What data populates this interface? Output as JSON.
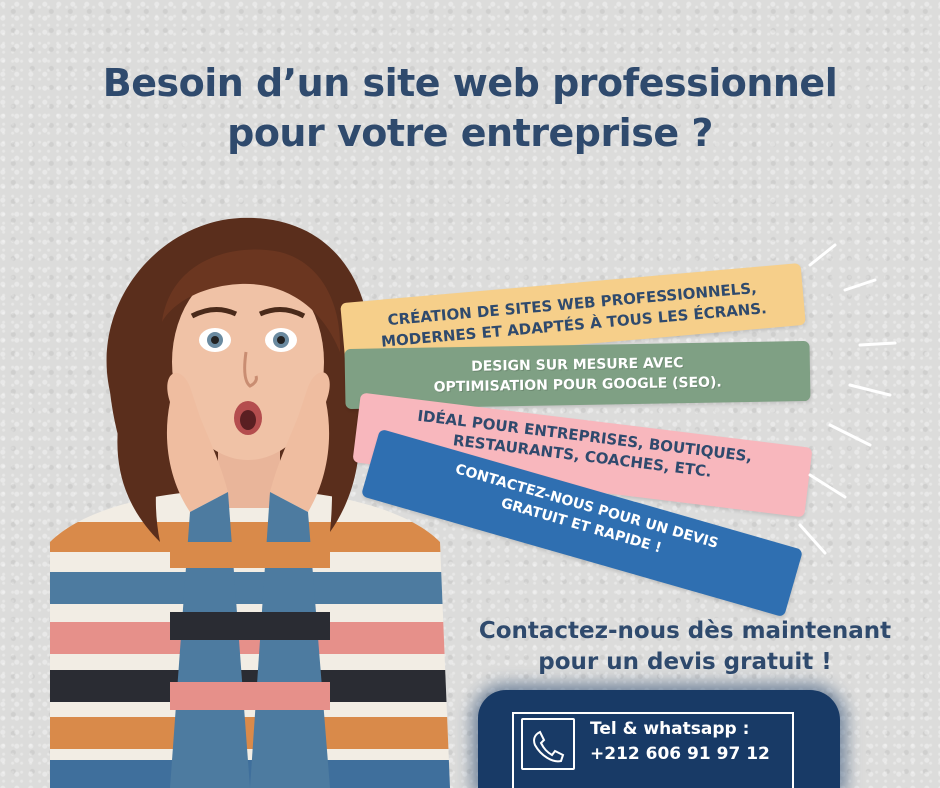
{
  "headline": {
    "line1": "Besoin d’un site web professionnel",
    "line2": "pour votre entreprise ?"
  },
  "banners": [
    {
      "lines": [
        "Création de sites web professionnels,",
        "modernes et adaptés à tous les écrans."
      ],
      "color": "#f6cf8a"
    },
    {
      "lines": [
        "Design sur mesure avec",
        "optimisation pour Google (SEO)."
      ],
      "color": "#7fa084"
    },
    {
      "lines": [
        "Idéal pour entreprises, boutiques,",
        "restaurants, coaches, etc."
      ],
      "color": "#f8b7bd"
    },
    {
      "lines": [
        "Contactez-nous pour un devis",
        "gratuit et rapide !"
      ],
      "color": "#2f6fb1"
    }
  ],
  "cta": {
    "line1": "Contactez-nous dès maintenant",
    "line2": "pour un devis gratuit !"
  },
  "contact": {
    "label": "Tel & whatsapp :",
    "phone": "+212 606 91 97 12",
    "icon": "phone-icon"
  },
  "colors": {
    "navy": "#2f4a6d",
    "splash": "#183a66"
  }
}
